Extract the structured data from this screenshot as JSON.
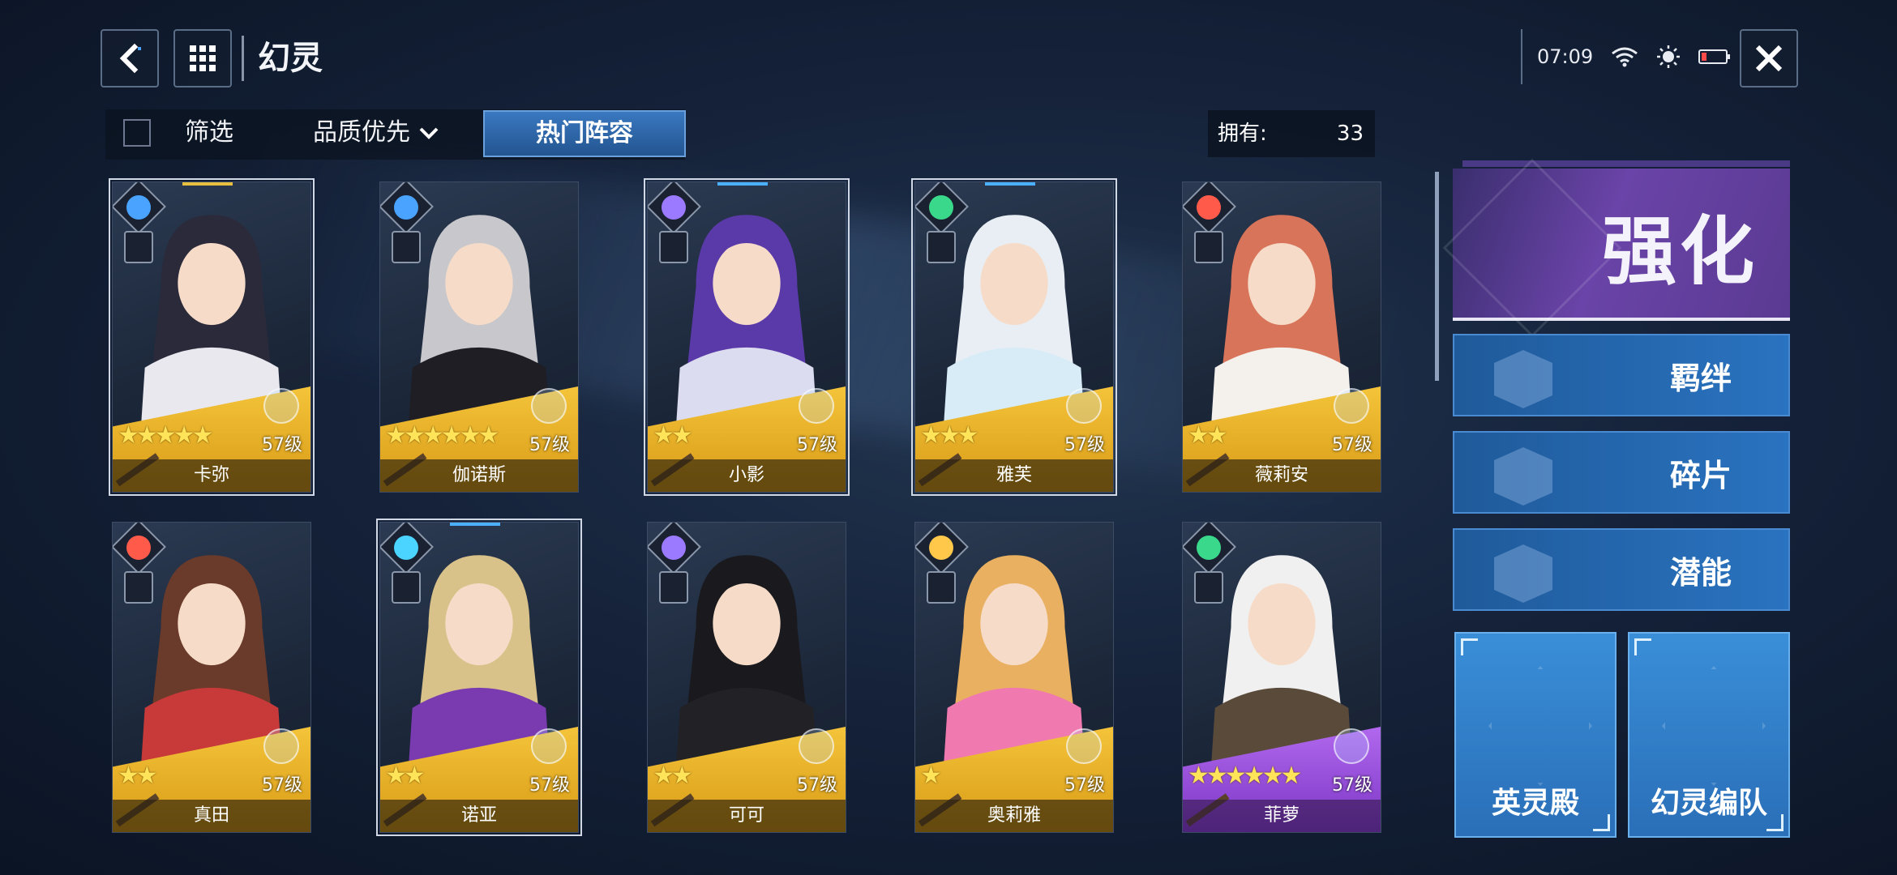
{
  "header": {
    "title": "幻灵",
    "time": "07:09",
    "back_icon": "back-arrow-icon",
    "menu_icon": "grid-menu-icon",
    "close_icon": "close-icon"
  },
  "filters": {
    "filter_label": "筛选",
    "sort_label": "品质优先",
    "hot_label": "热门阵容",
    "owned_label": "拥有:",
    "owned_count": "33"
  },
  "cards": [
    {
      "name": "卡弥",
      "level": "57级",
      "stars": 5,
      "rarity": "gold",
      "element": "lightning",
      "elem_color": "#4aa4ff",
      "hair": "#2a2a3a",
      "outfit": "#e8e8ee"
    },
    {
      "name": "伽诺斯",
      "level": "57级",
      "stars": 6,
      "rarity": "gold",
      "element": "lightning",
      "elem_color": "#4aa4ff",
      "hair": "#c8c8cc",
      "outfit": "#1e1e24"
    },
    {
      "name": "小影",
      "level": "57级",
      "stars": 2,
      "rarity": "gold",
      "element": "moon",
      "elem_color": "#9c7aff",
      "hair": "#5a3aa8",
      "outfit": "#dcdcf0"
    },
    {
      "name": "雅芙",
      "level": "57级",
      "stars": 3,
      "rarity": "gold",
      "element": "wind",
      "elem_color": "#3ad88a",
      "hair": "#e8eef4",
      "outfit": "#d8ecf8"
    },
    {
      "name": "薇莉安",
      "level": "57级",
      "stars": 2,
      "rarity": "gold",
      "element": "fire",
      "elem_color": "#ff5a4a",
      "hair": "#d8745a",
      "outfit": "#f4f0ec"
    },
    {
      "name": "真田",
      "level": "57级",
      "stars": 2,
      "rarity": "gold",
      "element": "fire",
      "elem_color": "#ff5a4a",
      "hair": "#6a3a2a",
      "outfit": "#c83a3a"
    },
    {
      "name": "诺亚",
      "level": "57级",
      "stars": 2,
      "rarity": "gold",
      "element": "water",
      "elem_color": "#4ad4ff",
      "hair": "#d8c28a",
      "outfit": "#7a3ab0"
    },
    {
      "name": "可可",
      "level": "57级",
      "stars": 2,
      "rarity": "gold",
      "element": "moon",
      "elem_color": "#9c7aff",
      "hair": "#1a1a1e",
      "outfit": "#222226"
    },
    {
      "name": "奥莉雅",
      "level": "57级",
      "stars": 1,
      "rarity": "gold",
      "element": "light",
      "elem_color": "#ffc84a",
      "hair": "#e8b060",
      "outfit": "#f07ab0"
    },
    {
      "name": "菲萝",
      "level": "57级",
      "stars": 6,
      "rarity": "purple",
      "element": "wind",
      "elem_color": "#3ad88a",
      "hair": "#f0f0f0",
      "outfit": "#5a4a3a"
    }
  ],
  "side": {
    "upgrade_label": "强化",
    "bond_label": "羁绊",
    "fragment_label": "碎片",
    "potential_label": "潜能",
    "hall_label": "英灵殿",
    "team_label": "幻灵编队"
  }
}
